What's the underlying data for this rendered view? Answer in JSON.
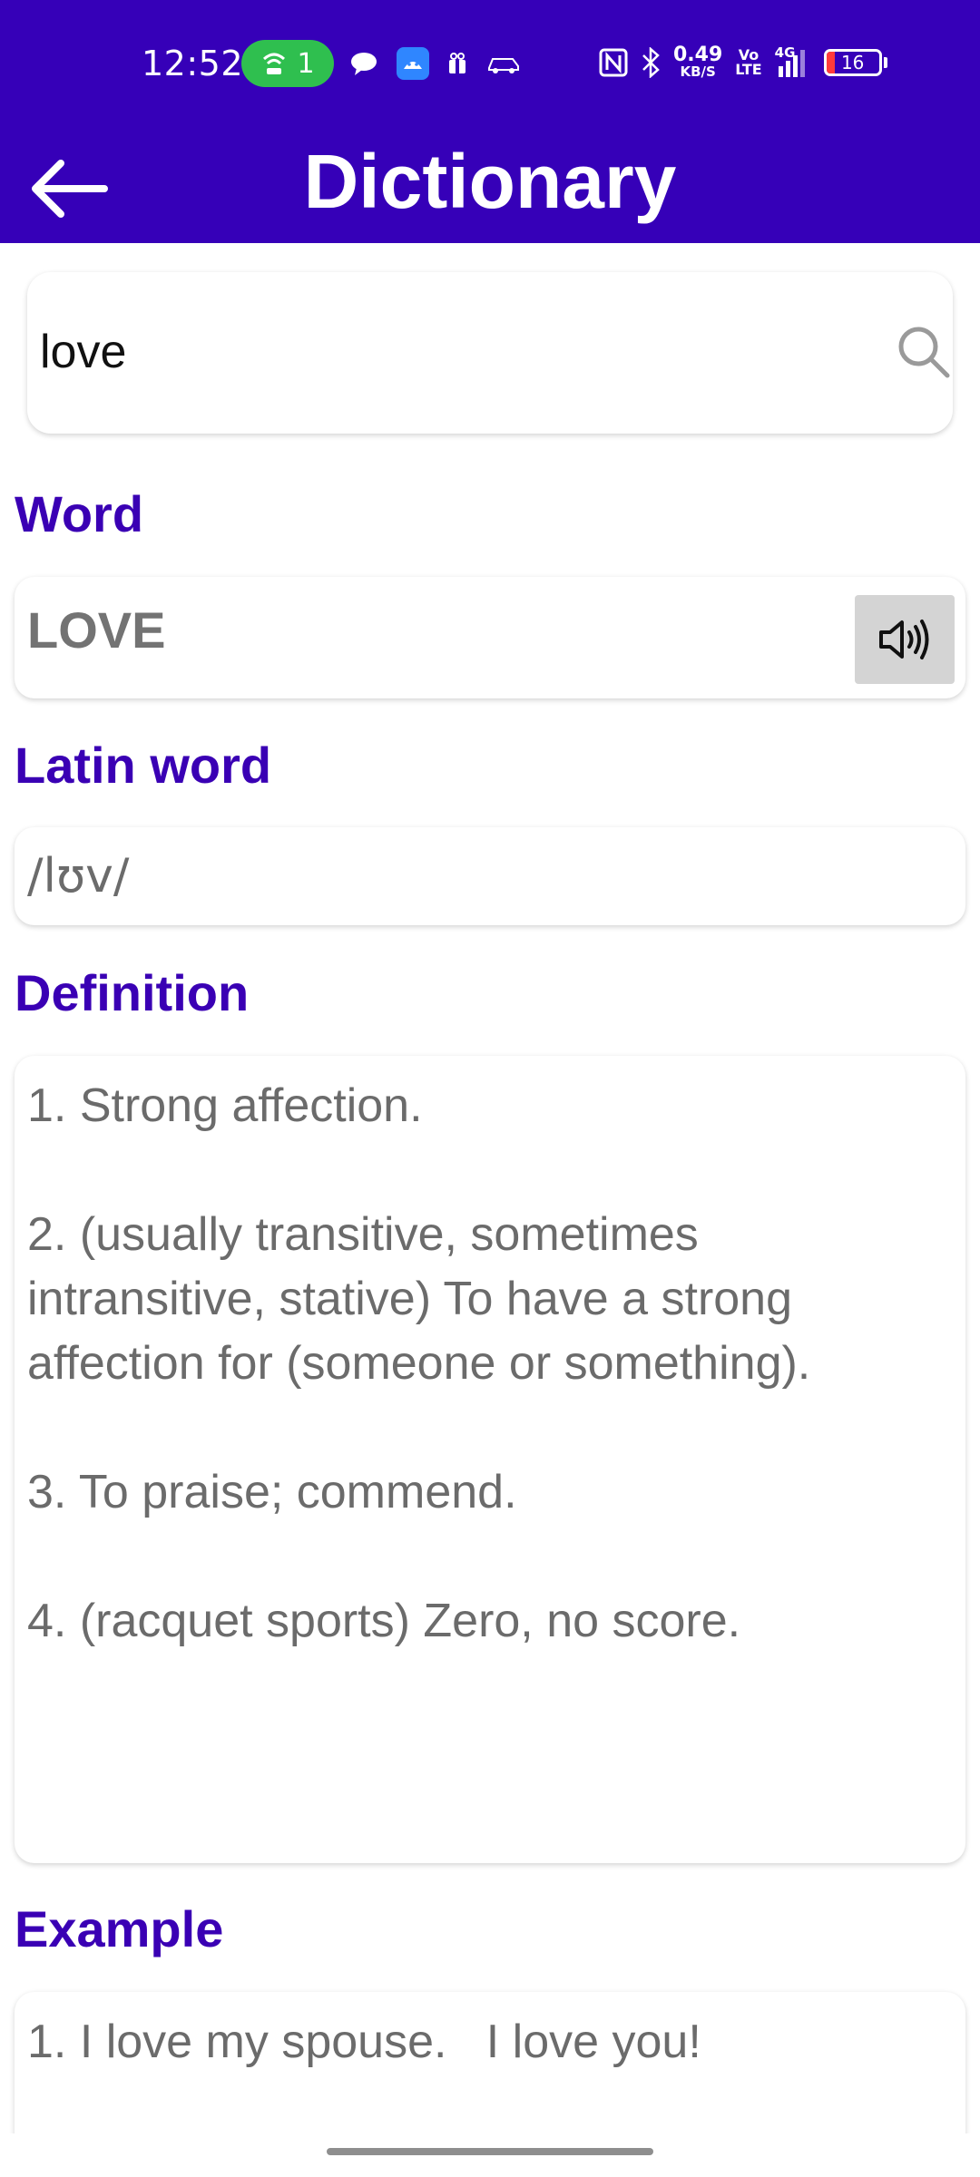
{
  "status_bar": {
    "time": "12:52",
    "hotspot_count": "1",
    "net_speed_value": "0.49",
    "net_speed_unit": "KB/S",
    "volte_top": "Vo",
    "volte_bottom": "LTE",
    "network": "4G",
    "battery_level": "16",
    "battery_color": "#ff3b3b"
  },
  "app_bar": {
    "title": "Dictionary",
    "back_icon": "arrow-left-icon",
    "background": "#3600b8"
  },
  "search": {
    "value": "love",
    "icon": "search-icon"
  },
  "sections": {
    "word_label": "Word",
    "latin_label": "Latin word",
    "definition_label": "Definition",
    "example_label": "Example"
  },
  "result": {
    "word": "LOVE",
    "speak_icon": "speaker-icon",
    "latin": "/lʊv/",
    "definitions": [
      "1. Strong affection.",
      "2. (usually transitive, sometimes intransitive, stative) To have a strong affection for (someone or something).",
      "3. To praise; commend.",
      "4. (racquet sports) Zero, no score."
    ],
    "example": "1. I love my spouse.   I love you!"
  },
  "colors": {
    "accent": "#3a00b4",
    "text_gray": "#6b6b6b"
  }
}
